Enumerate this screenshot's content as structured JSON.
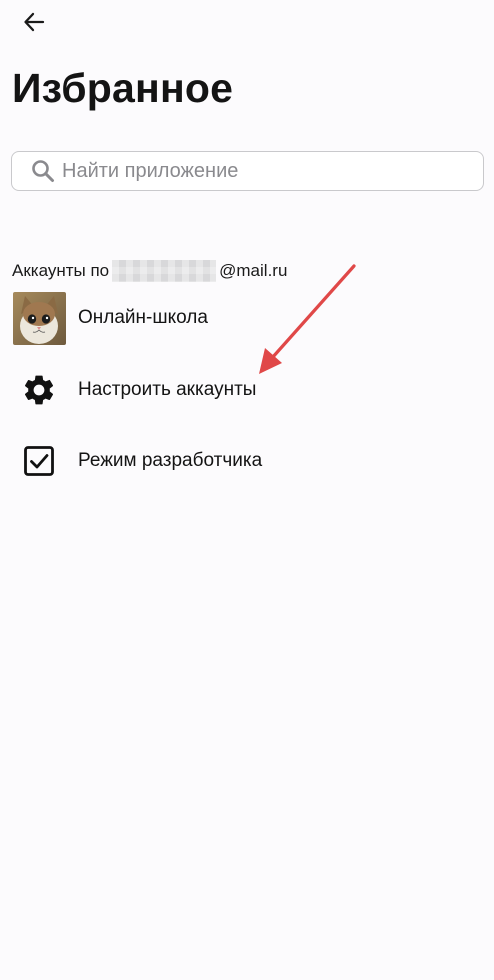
{
  "header": {
    "title": "Избранное"
  },
  "search": {
    "placeholder": "Найти приложение",
    "value": ""
  },
  "accounts_section": {
    "label_prefix": "Аккаунты по",
    "label_suffix": "@mail.ru"
  },
  "items": [
    {
      "label": "Онлайн-школа",
      "icon": "cat-avatar"
    },
    {
      "label": "Настроить аккаунты",
      "icon": "gear-icon"
    },
    {
      "label": "Режим разработчика",
      "icon": "checkbox-checked-icon",
      "checked": true
    }
  ],
  "colors": {
    "background": "#fcfbfd",
    "annotation_arrow": "#e04848",
    "placeholder": "#8a8a8e"
  }
}
